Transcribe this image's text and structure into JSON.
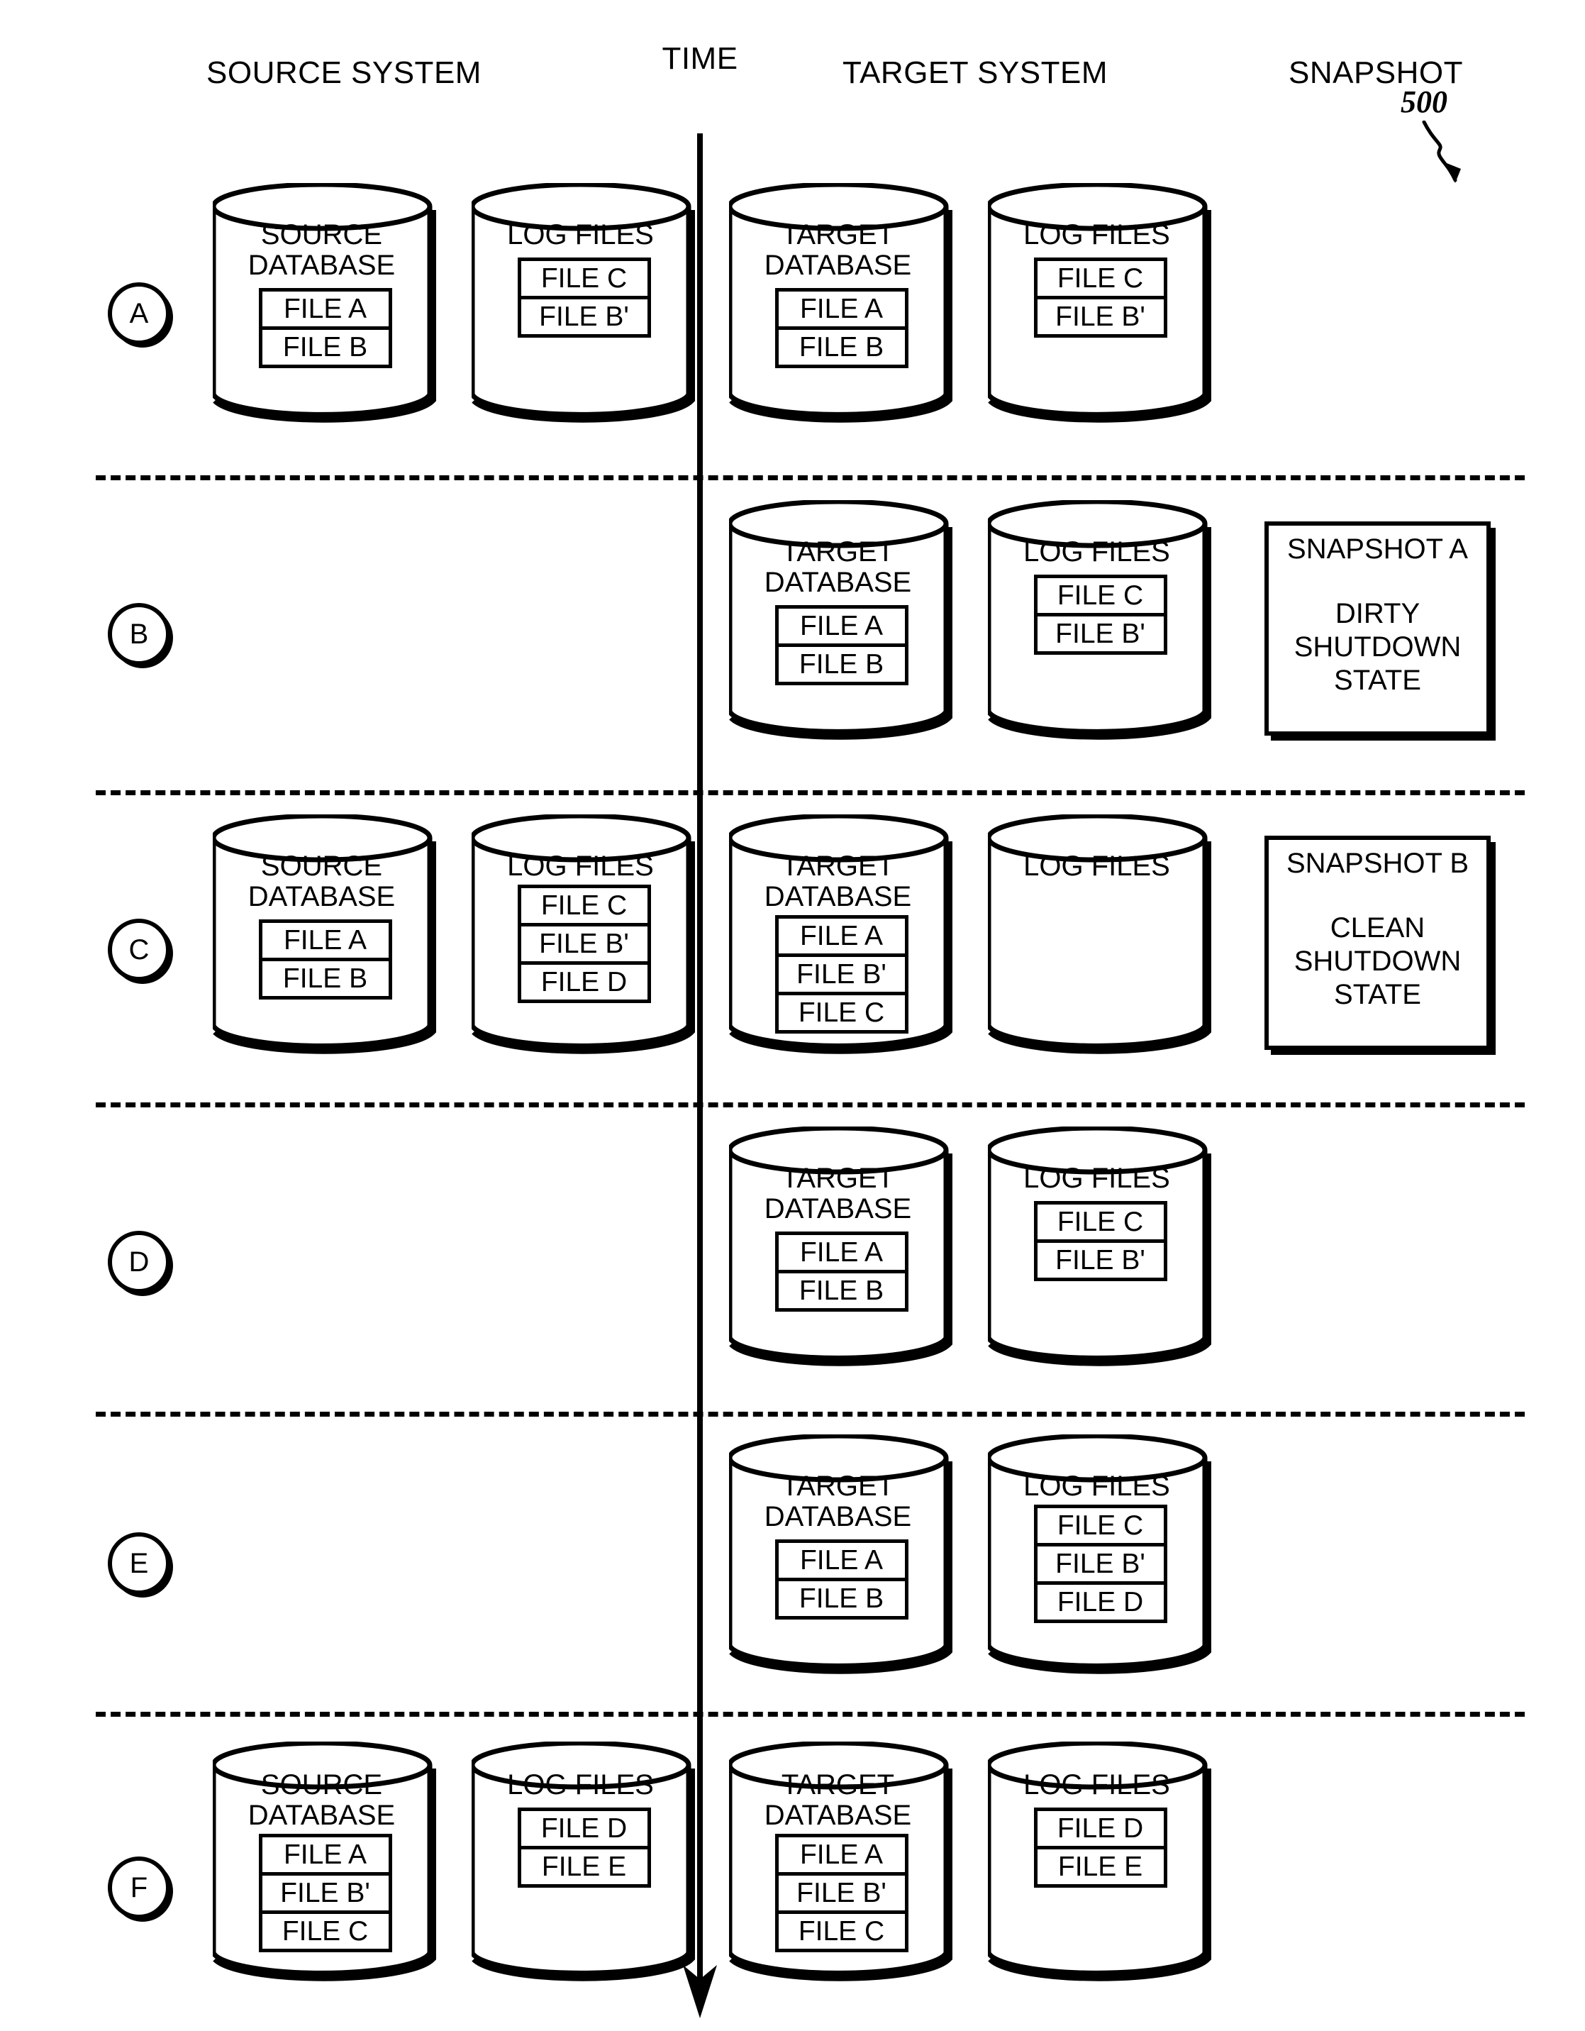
{
  "figure": {
    "reference_numeral": "500",
    "headers": {
      "source_system": "SOURCE SYSTEM",
      "time": "TIME",
      "target_system": "TARGET SYSTEM",
      "snapshot": "SNAPSHOT"
    }
  },
  "labels": {
    "source_database": "SOURCE\nDATABASE",
    "target_database": "TARGET\nDATABASE",
    "log_files": "LOG FILES"
  },
  "rows": [
    {
      "marker": "A",
      "source_database": {
        "label": "SOURCE\nDATABASE",
        "files": [
          "FILE A",
          "FILE B"
        ]
      },
      "source_logs": {
        "label": "LOG FILES",
        "files": [
          "FILE C",
          "FILE B'"
        ]
      },
      "target_database": {
        "label": "TARGET\nDATABASE",
        "files": [
          "FILE A",
          "FILE B"
        ]
      },
      "target_logs": {
        "label": "LOG FILES",
        "files": [
          "FILE C",
          "FILE B'"
        ]
      },
      "snapshot": null
    },
    {
      "marker": "B",
      "source_database": null,
      "source_logs": null,
      "target_database": {
        "label": "TARGET\nDATABASE",
        "files": [
          "FILE A",
          "FILE B"
        ]
      },
      "target_logs": {
        "label": "LOG FILES",
        "files": [
          "FILE C",
          "FILE B'"
        ]
      },
      "snapshot": {
        "title": "SNAPSHOT A",
        "state": "DIRTY\nSHUTDOWN\nSTATE"
      }
    },
    {
      "marker": "C",
      "source_database": {
        "label": "SOURCE\nDATABASE",
        "files": [
          "FILE A",
          "FILE B"
        ]
      },
      "source_logs": {
        "label": "LOG FILES",
        "files": [
          "FILE C",
          "FILE B'",
          "FILE D"
        ]
      },
      "target_database": {
        "label": "TARGET\nDATABASE",
        "files": [
          "FILE A",
          "FILE B'",
          "FILE C"
        ]
      },
      "target_logs": {
        "label": "LOG FILES",
        "files": []
      },
      "snapshot": {
        "title": "SNAPSHOT B",
        "state": "CLEAN\nSHUTDOWN\nSTATE"
      }
    },
    {
      "marker": "D",
      "source_database": null,
      "source_logs": null,
      "target_database": {
        "label": "TARGET\nDATABASE",
        "files": [
          "FILE A",
          "FILE B"
        ]
      },
      "target_logs": {
        "label": "LOG FILES",
        "files": [
          "FILE C",
          "FILE B'"
        ]
      },
      "snapshot": null
    },
    {
      "marker": "E",
      "source_database": null,
      "source_logs": null,
      "target_database": {
        "label": "TARGET\nDATABASE",
        "files": [
          "FILE A",
          "FILE B"
        ]
      },
      "target_logs": {
        "label": "LOG FILES",
        "files": [
          "FILE C",
          "FILE B'",
          "FILE D"
        ]
      },
      "snapshot": null
    },
    {
      "marker": "F",
      "source_database": {
        "label": "SOURCE\nDATABASE",
        "files": [
          "FILE A",
          "FILE B'",
          "FILE C"
        ]
      },
      "source_logs": {
        "label": "LOG FILES",
        "files": [
          "FILE D",
          "FILE E"
        ]
      },
      "target_database": {
        "label": "TARGET\nDATABASE",
        "files": [
          "FILE A",
          "FILE B'",
          "FILE C"
        ]
      },
      "target_logs": {
        "label": "LOG FILES",
        "files": [
          "FILE D",
          "FILE E"
        ]
      },
      "snapshot": null
    }
  ]
}
